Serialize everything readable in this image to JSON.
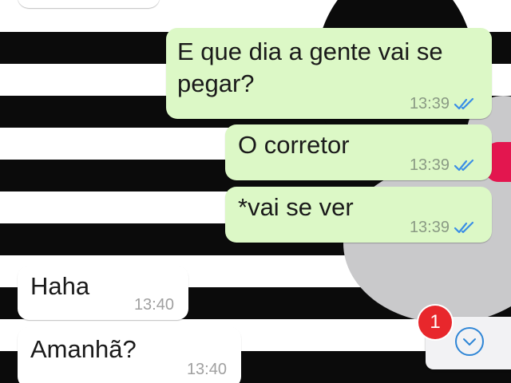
{
  "messages": [
    {
      "text": "E que dia a gente vai se pegar?",
      "time": "13:39",
      "direction": "outgoing",
      "status": "read"
    },
    {
      "text": "O corretor",
      "time": "13:39",
      "direction": "outgoing",
      "status": "read"
    },
    {
      "text": "*vai se ver",
      "time": "13:39",
      "direction": "outgoing",
      "status": "read"
    },
    {
      "text": "Haha",
      "time": "13:40",
      "direction": "incoming"
    },
    {
      "text": "Amanhã?",
      "time": "13:40",
      "direction": "incoming"
    }
  ],
  "scroll_to_bottom": {
    "unread_count": "1",
    "icon": "chevron-down-icon"
  },
  "colors": {
    "outgoing_bubble": "#dcf8c6",
    "incoming_bubble": "#ffffff",
    "read_ticks": "#3a8ee6",
    "badge": "#e8272c"
  }
}
